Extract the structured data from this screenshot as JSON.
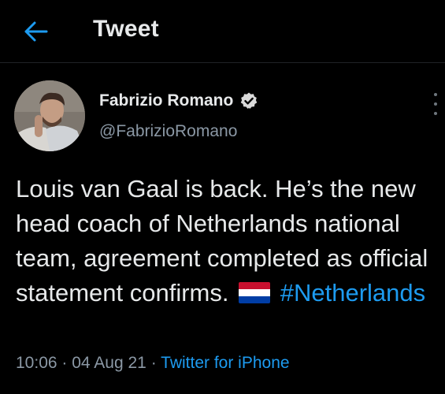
{
  "header": {
    "title": "Tweet",
    "back_icon": "arrow-left-icon",
    "accent_color": "#1d9bf0"
  },
  "tweet": {
    "author_name": "Fabrizio Romano",
    "verified_icon": "verified-badge-icon",
    "handle": "@FabrizioRomano",
    "more_icon": "more-vertical-icon",
    "text": "Louis van Gaal is back. He’s the new head coach of Netherlands national team, agreement completed as official statement confirms.",
    "flag_icon": "netherlands-flag-icon",
    "hashtag": "#Netherlands",
    "time": "10:06",
    "date": "04 Aug 21",
    "separator": "·",
    "source": "Twitter for iPhone"
  },
  "colors": {
    "background": "#000000",
    "text_primary": "#e7e9ea",
    "text_secondary": "#8b98a5",
    "link": "#1d9bf0",
    "verified": "#d9d9d9"
  }
}
